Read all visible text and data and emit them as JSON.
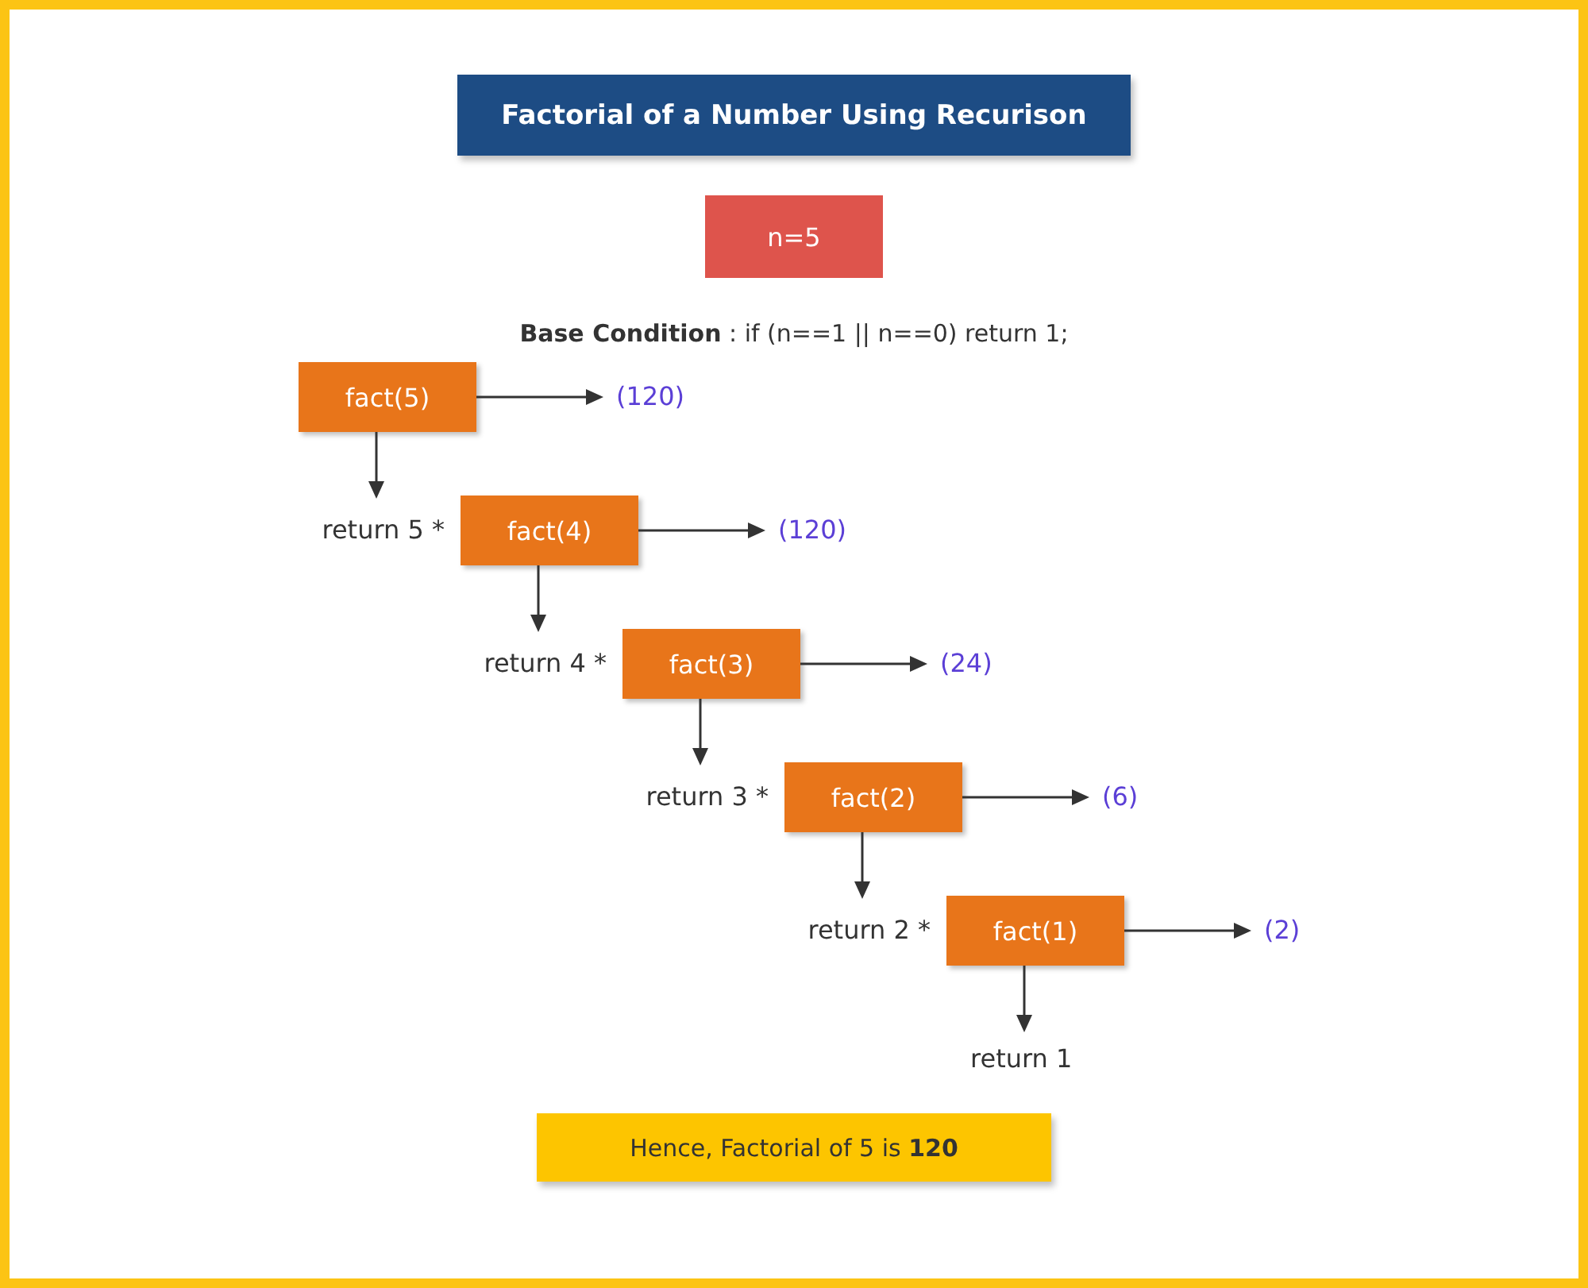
{
  "title": "Factorial of a Number Using Recurison",
  "input": "n=5",
  "base_condition": "**Base Condition** : if (n==1 || n==0) return 1;",
  "steps": [
    {
      "call": "fact(5)",
      "result": "(120)"
    },
    {
      "prefix": "return 5 *",
      "call": "fact(4)",
      "result": "(120)"
    },
    {
      "prefix": "return 4 *",
      "call": "fact(3)",
      "result": "(24)"
    },
    {
      "prefix": "return 3 *",
      "call": "fact(2)",
      "result": "(6)"
    },
    {
      "prefix": "return 2 *",
      "call": "fact(1)",
      "result": "(2)"
    }
  ],
  "final_return": "return 1",
  "conclusion": "Hence, Factorial of 5 is **120**"
}
